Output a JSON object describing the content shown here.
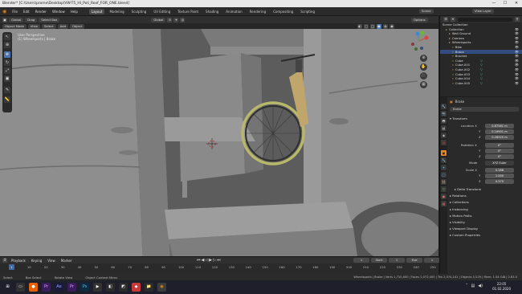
{
  "window": {
    "title": "Blender* [C:\\Users\\prome\\Desktop\\VW-T5_HI_Poli_Roof_FOR_ONE.blend]",
    "min": "—",
    "max": "☐",
    "close": "✕"
  },
  "menu": [
    "File",
    "Edit",
    "Render",
    "Window",
    "Help"
  ],
  "workspaces": [
    "Layout",
    "Modeling",
    "Sculpting",
    "UV Editing",
    "Texture Paint",
    "Shading",
    "Animation",
    "Rendering",
    "Compositing",
    "Scripting"
  ],
  "scene": {
    "label": "Scene",
    "view_layer": "View Layer"
  },
  "header": {
    "mode": "Object Mode",
    "view": "View",
    "select": "Select",
    "add": "Add",
    "object": "Object",
    "orientation": "Global",
    "drag": "Drag",
    "select_box": "Select Box",
    "transform": "Global",
    "options": "Options"
  },
  "viewport": {
    "line1": "User Perspective",
    "line2": "(1) Wheelsports | Brake"
  },
  "timeline": {
    "menus": [
      "Playback",
      "Keying",
      "View",
      "Marker"
    ],
    "current_frame": "1",
    "start_label": "Start",
    "start": "1",
    "end_label": "End",
    "end": "1",
    "ticks": [
      "0",
      "10",
      "20",
      "30",
      "40",
      "50",
      "60",
      "70",
      "80",
      "90",
      "100",
      "110",
      "120",
      "130",
      "140",
      "150",
      "160",
      "170",
      "180",
      "190",
      "200",
      "210",
      "220",
      "230",
      "240",
      "250"
    ]
  },
  "status": {
    "left": "Select",
    "mid1": "Box Select",
    "mid2": "Rotate View",
    "mid3": "Object Context Menu",
    "stats": "Wheelsports | Brake | Verts 1,720,000 | Faces 1,072,000 | Tris 2,074,141 | Objects 1/129 | Mem: 1.54 GiB | 2.83.0"
  },
  "outliner": {
    "title": "Scene Collection",
    "items": [
      {
        "name": "Collection"
      },
      {
        "name": "Wall Ground"
      },
      {
        "name": "Camera"
      },
      {
        "name": "Wheelsports"
      },
      {
        "name": "Bike"
      },
      {
        "name": "Brake"
      },
      {
        "name": "Bracket"
      },
      {
        "name": "Cube"
      },
      {
        "name": "Cube.001"
      },
      {
        "name": "Cube.002"
      },
      {
        "name": "Cube.003"
      },
      {
        "name": "Cube.004"
      },
      {
        "name": "Cube.005"
      }
    ]
  },
  "properties": {
    "object_name": "Brake",
    "datablock": "Brake",
    "transform_label": "Transform",
    "location_label": "Location X",
    "loc": [
      "0.87561 m",
      "0.18901 m",
      "0.28925 m"
    ],
    "rotation_label": "Rotation X",
    "rot": [
      "0°",
      "0°",
      "0°"
    ],
    "mode_label": "Mode",
    "mode": "XYZ Euler",
    "scale_label": "Scale X",
    "scale": [
      "0.288",
      "1.000",
      "0.575"
    ],
    "axis_y": "Y",
    "axis_z": "Z",
    "sections": [
      "Delta Transform",
      "Relations",
      "Collections",
      "Instancing",
      "Motion Paths",
      "Visibility",
      "Viewport Display",
      "Custom Properties"
    ]
  },
  "taskbar": {
    "time": "22:05",
    "date": "01.02.2020"
  }
}
